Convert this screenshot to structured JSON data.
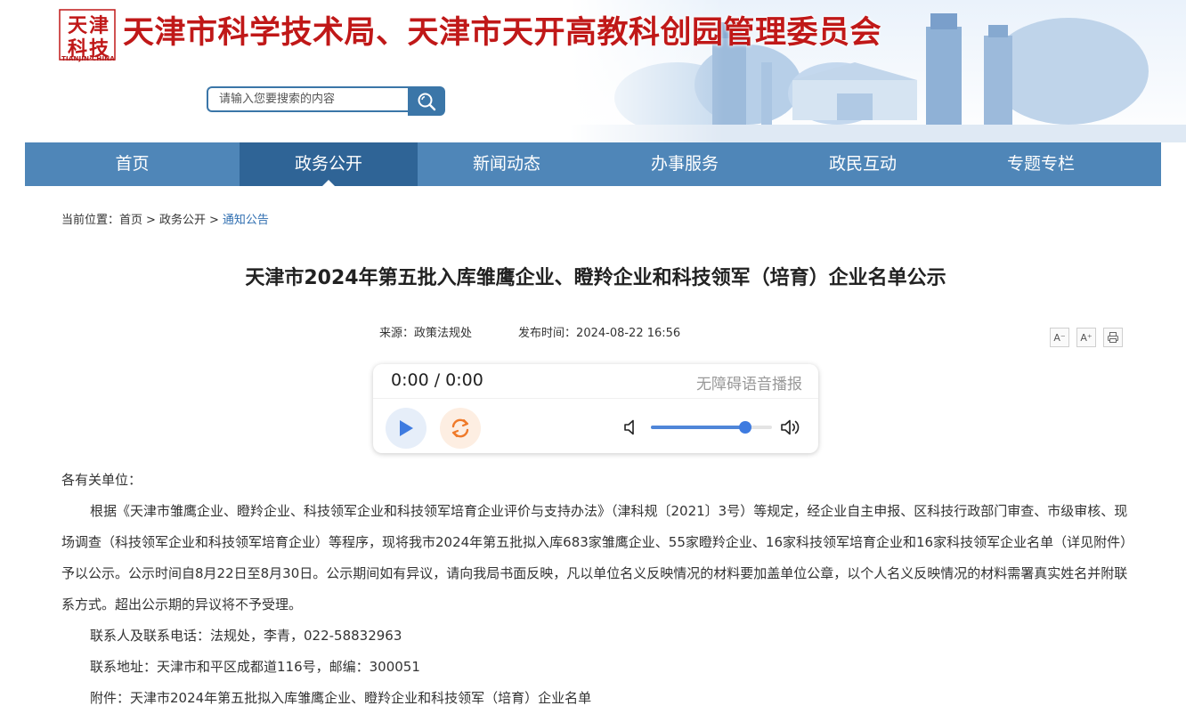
{
  "header": {
    "logo_chars": [
      "天",
      "津",
      "科",
      "技"
    ],
    "logo_sub": "TIANJIN·CHINA",
    "site_title": "天津市科学技术局、天津市天开高教科创园管理委员会",
    "search_placeholder": "请输入您要搜索的内容",
    "search_icon": "search-icon"
  },
  "nav": {
    "items": [
      {
        "label": "首页"
      },
      {
        "label": "政务公开"
      },
      {
        "label": "新闻动态"
      },
      {
        "label": "办事服务"
      },
      {
        "label": "政民互动"
      },
      {
        "label": "专题专栏"
      }
    ],
    "active_index": 1
  },
  "breadcrumb": {
    "prefix": "当前位置：",
    "items": [
      "首页",
      "政务公开",
      "通知公告"
    ],
    "separator": ">"
  },
  "article": {
    "title": "天津市2024年第五批入库雏鹰企业、瞪羚企业和科技领军（培育）企业名单公示",
    "source_label": "来源：",
    "source": "政策法规处",
    "date_label": "发布时间：",
    "date": "2024-08-22 16:56",
    "tools": {
      "font_smaller": "A⁻",
      "font_larger": "A⁺",
      "print_icon": "print-icon"
    }
  },
  "player": {
    "time": "0:00 / 0:00",
    "label": "无障碍语音播报",
    "volume": 0.78,
    "play_icon": "play-icon",
    "replay_icon": "replay-icon",
    "volume_low_icon": "volume-low-icon",
    "volume_high_icon": "volume-high-icon",
    "accent_color": "#3e7be0"
  },
  "content": {
    "greeting": "各有关单位：",
    "paragraph": "根据《天津市雏鹰企业、瞪羚企业、科技领军企业和科技领军培育企业评价与支持办法》（津科规〔2021〕3号）等规定，经企业自主申报、区科技行政部门审查、市级审核、现场调查（科技领军企业和科技领军培育企业）等程序，现将我市2024年第五批拟入库683家雏鹰企业、55家瞪羚企业、16家科技领军培育企业和16家科技领军企业名单（详见附件）予以公示。公示时间自8月22日至8月30日。公示期间如有异议，请向我局书面反映，凡以单位名义反映情况的材料要加盖单位公章，以个人名义反映情况的材料需署真实姓名并附联系方式。超出公示期的异议将不予受理。",
    "contact": "联系人及联系电话：法规处，李青，022-58832963",
    "address": "联系地址：天津市和平区成都道116号，邮编：300051",
    "attachment": "附件：天津市2024年第五批拟入库雏鹰企业、瞪羚企业和科技领军（培育）企业名单"
  },
  "colors": {
    "title_red": "#c01818",
    "nav_blue": "#4f86b8",
    "nav_active": "#2f6496",
    "link_blue": "#2f6eb0"
  }
}
